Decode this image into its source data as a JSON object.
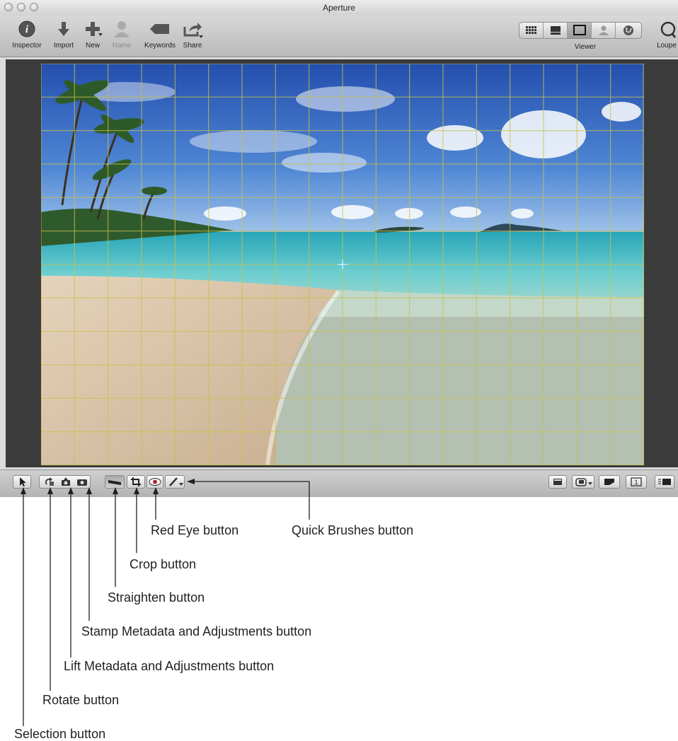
{
  "window": {
    "title": "Aperture"
  },
  "toolbar": {
    "items": [
      {
        "label": "Inspector",
        "icon": "info-icon",
        "enabled": true
      },
      {
        "label": "Import",
        "icon": "import-arrow-icon",
        "enabled": true
      },
      {
        "label": "New",
        "icon": "plus-icon",
        "enabled": true
      },
      {
        "label": "Name",
        "icon": "person-icon",
        "enabled": false
      },
      {
        "label": "Keywords",
        "icon": "tag-icon",
        "enabled": true
      },
      {
        "label": "Share",
        "icon": "share-icon",
        "enabled": true
      }
    ],
    "view_label": "Viewer",
    "loupe_label": "Loupe",
    "view_modes": [
      "grid-view-icon",
      "filmstrip-view-icon",
      "viewer-icon",
      "faces-icon",
      "places-globe-icon"
    ],
    "active_view": "viewer-icon"
  },
  "bottom_tools": {
    "left": [
      "selection-arrow-icon",
      "rotate-icon",
      "lift-icon",
      "stamp-icon",
      "straighten-icon",
      "crop-icon",
      "red-eye-icon",
      "quick-brush-icon"
    ],
    "active": "straighten-icon",
    "right": [
      "filmstrip-toggle-icon",
      "overlay-menu-icon",
      "split-view-icon",
      "primary-only-icon",
      "fullscreen-icon"
    ],
    "primary_only_number": "1"
  },
  "callouts": {
    "red_eye": "Red Eye button",
    "quick_brushes": "Quick Brushes button",
    "crop": "Crop button",
    "straighten": "Straighten button",
    "stamp": "Stamp Metadata and Adjustments button",
    "lift": "Lift Metadata and Adjustments button",
    "rotate": "Rotate button",
    "selection": "Selection button"
  },
  "colors": {
    "grid_line": "#c8c24a",
    "viewer_bg": "#3b3b3b",
    "sky_top": "#2d57b4",
    "sea": "#3fb8c4",
    "sand": "#d9c2a6",
    "red_eye": "#b6262d"
  }
}
